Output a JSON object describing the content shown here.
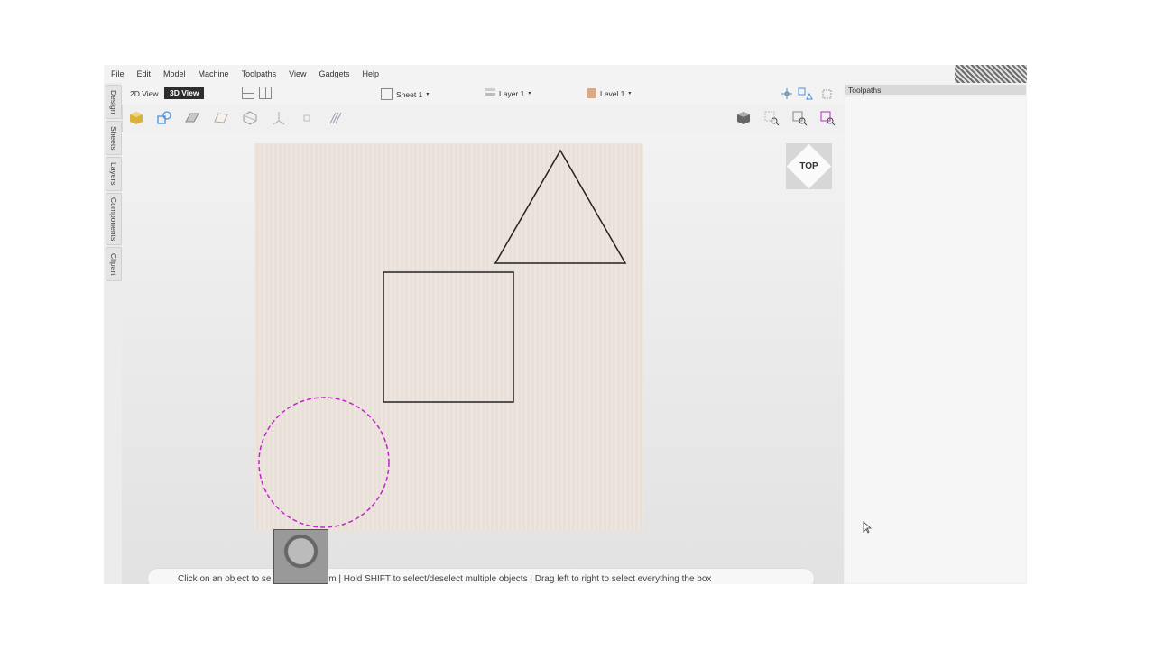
{
  "menu": [
    "File",
    "Edit",
    "Model",
    "Machine",
    "Toolpaths",
    "View",
    "Gadgets",
    "Help"
  ],
  "left_tabs": [
    "Design",
    "Sheets",
    "Layers",
    "Components",
    "Clipart"
  ],
  "view_toggle": {
    "view2d": "2D View",
    "view3d": "3D View",
    "active": "3D View"
  },
  "dropdowns": {
    "sheet": "Sheet 1",
    "layer": "Layer 1",
    "level": "Level 1"
  },
  "nav_cube": {
    "label": "TOP"
  },
  "status": {
    "hint": "Click on an object to se              ain to transform | Hold SHIFT to select/deselect multiple objects | Drag left to right to select everything the box"
  },
  "right_panel": {
    "title": "Toolpaths"
  },
  "colors": {
    "selection": "#c026c9",
    "outline": "#222222",
    "material": "#ece4dc"
  },
  "icons": {
    "tools": [
      "material-cube-icon",
      "shapes-icon",
      "plane-icon",
      "sheet-icon",
      "mesh-icon",
      "axis-icon",
      "node-icon",
      "hatch-icon"
    ],
    "right_tools": [
      "render-cube-icon",
      "zoom-selected-icon",
      "zoom-extents-icon",
      "zoom-box-icon"
    ]
  }
}
